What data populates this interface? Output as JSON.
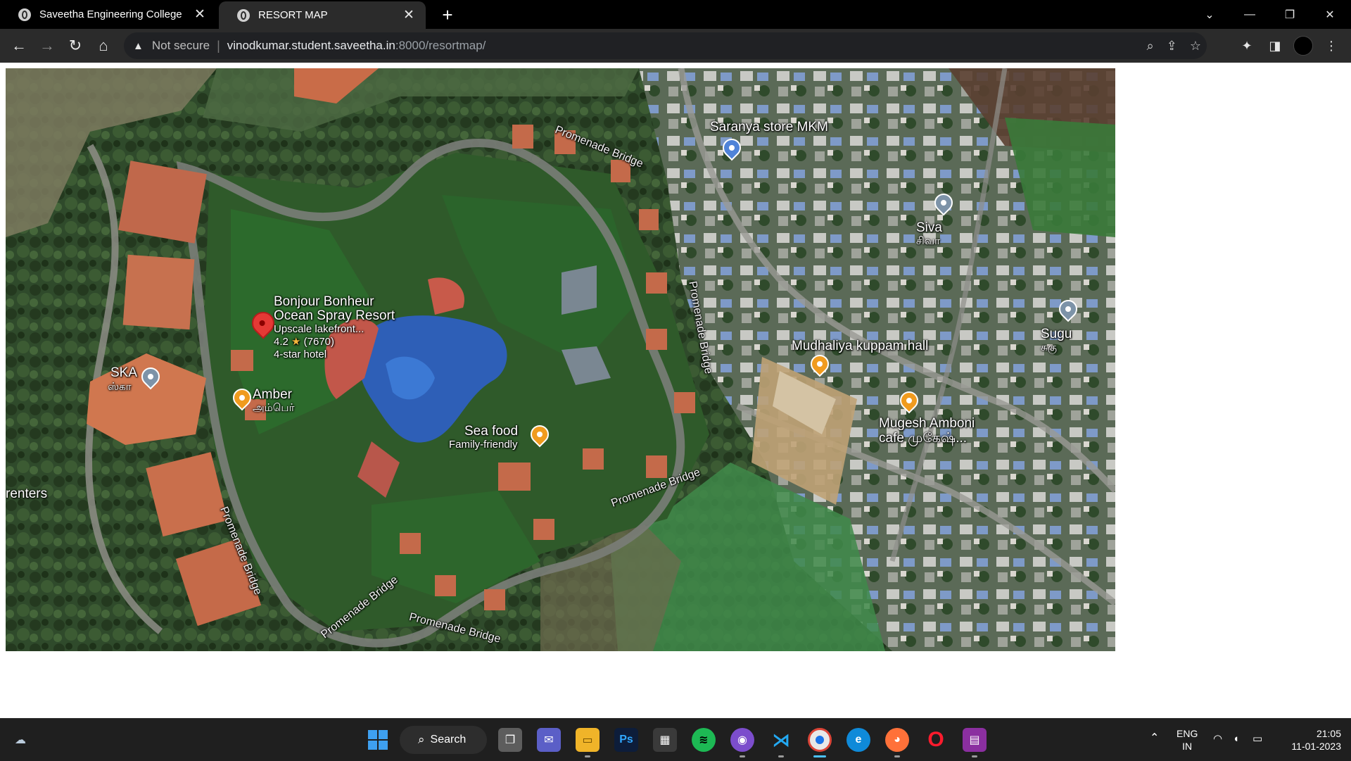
{
  "browser": {
    "tabs": [
      {
        "title": "Saveetha Engineering College",
        "active": false
      },
      {
        "title": "RESORT MAP",
        "active": true
      }
    ],
    "security_label": "Not secure",
    "url_host": "vinodkumar.student.saveetha.in",
    "url_rest": ":8000/resortmap/"
  },
  "map": {
    "resort": {
      "name_line1": "Bonjour Bonheur",
      "name_line2": "Ocean Spray Resort",
      "description": "Upscale lakefront...",
      "rating": "4.2",
      "star": "★",
      "reviews": "(7670)",
      "category": "4-star hotel"
    },
    "places": {
      "saranya": "Saranya store MKM",
      "siva": "Siva",
      "siva_tamil": "சிவா",
      "sugu": "Sugu",
      "sugu_tamil": "சுகு",
      "mudhaliya": "Mudhaliya kuppam hall",
      "mugesh_line1": "Mugesh Amboni",
      "mugesh_line2": "cafe முகேஷ்...",
      "ska": "SKA",
      "ska_tamil": "ஸ்கா",
      "amber": "Amber",
      "amber_tamil": "அம்பெர்",
      "seafood": "Sea food",
      "seafood_sub": "Family-friendly",
      "renters": "renters"
    },
    "roads": {
      "r1": "Promenade Bridge",
      "r2": "Promenade Bridge",
      "r3": "Promenade Bridge",
      "r4": "Promenade Bridge",
      "r5": "Promenade Bridge",
      "r6": "Promenade Bridge"
    }
  },
  "taskbar": {
    "search_label": "Search",
    "language_line1": "ENG",
    "language_line2": "IN",
    "time": "21:05",
    "date": "11-01-2023"
  }
}
